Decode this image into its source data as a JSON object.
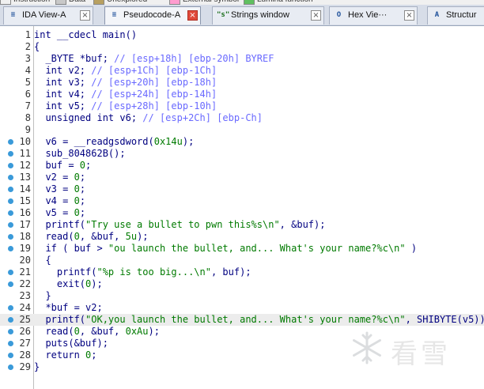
{
  "legend": [
    {
      "label": "Instruction",
      "color": "#f0f0f0"
    },
    {
      "label": "Data",
      "color": "#c8c8c8"
    },
    {
      "label": "Unexplored",
      "color": "#b8a060"
    },
    {
      "label": "External symbol",
      "color": "#ff9ccf"
    },
    {
      "label": "Lumina function",
      "color": "#60c060"
    }
  ],
  "tabs": [
    {
      "label": "IDA View-A",
      "icon": "ida-view-icon",
      "glyph": "≡",
      "active": false
    },
    {
      "label": "Pseudocode-A",
      "icon": "pseudocode-icon",
      "glyph": "≡",
      "active": true
    },
    {
      "label": "Strings window",
      "icon": "strings-icon",
      "glyph": "\"s\"",
      "active": false
    },
    {
      "label": "Hex Vie···",
      "icon": "hex-view-icon",
      "glyph": "O",
      "active": false
    },
    {
      "label": "Structur",
      "icon": "structures-icon",
      "glyph": "A",
      "active": false
    }
  ],
  "code_lines": [
    {
      "n": "1",
      "dot": false,
      "hl": false,
      "tokens": [
        [
          "kw",
          "int"
        ],
        [
          "txt",
          " __cdecl main()"
        ]
      ]
    },
    {
      "n": "2",
      "dot": false,
      "hl": false,
      "tokens": [
        [
          "blk",
          "{"
        ]
      ]
    },
    {
      "n": "3",
      "dot": false,
      "hl": false,
      "tokens": [
        [
          "txt",
          "  _BYTE *buf; "
        ],
        [
          "cm",
          "// [esp+18h] [ebp-20h] BYREF"
        ]
      ]
    },
    {
      "n": "4",
      "dot": false,
      "hl": false,
      "tokens": [
        [
          "txt",
          "  int v2; "
        ],
        [
          "cm",
          "// [esp+1Ch] [ebp-1Ch]"
        ]
      ]
    },
    {
      "n": "5",
      "dot": false,
      "hl": false,
      "tokens": [
        [
          "txt",
          "  int v3; "
        ],
        [
          "cm",
          "// [esp+20h] [ebp-18h]"
        ]
      ]
    },
    {
      "n": "6",
      "dot": false,
      "hl": false,
      "tokens": [
        [
          "txt",
          "  int v4; "
        ],
        [
          "cm",
          "// [esp+24h] [ebp-14h]"
        ]
      ]
    },
    {
      "n": "7",
      "dot": false,
      "hl": false,
      "tokens": [
        [
          "txt",
          "  int v5; "
        ],
        [
          "cm",
          "// [esp+28h] [ebp-10h]"
        ]
      ]
    },
    {
      "n": "8",
      "dot": false,
      "hl": false,
      "tokens": [
        [
          "txt",
          "  unsigned int v6; "
        ],
        [
          "cm",
          "// [esp+2Ch] [ebp-Ch]"
        ]
      ]
    },
    {
      "n": "9",
      "dot": false,
      "hl": false,
      "tokens": []
    },
    {
      "n": "10",
      "dot": true,
      "hl": false,
      "tokens": [
        [
          "txt",
          "  v6 = __readgsdword("
        ],
        [
          "num",
          "0x14u"
        ],
        [
          "txt",
          ");"
        ]
      ]
    },
    {
      "n": "11",
      "dot": true,
      "hl": false,
      "tokens": [
        [
          "txt",
          "  sub_804862B();"
        ]
      ]
    },
    {
      "n": "12",
      "dot": true,
      "hl": false,
      "tokens": [
        [
          "txt",
          "  buf = "
        ],
        [
          "num",
          "0"
        ],
        [
          "txt",
          ";"
        ]
      ]
    },
    {
      "n": "13",
      "dot": true,
      "hl": false,
      "tokens": [
        [
          "txt",
          "  v2 = "
        ],
        [
          "num",
          "0"
        ],
        [
          "txt",
          ";"
        ]
      ]
    },
    {
      "n": "14",
      "dot": true,
      "hl": false,
      "tokens": [
        [
          "txt",
          "  v3 = "
        ],
        [
          "num",
          "0"
        ],
        [
          "txt",
          ";"
        ]
      ]
    },
    {
      "n": "15",
      "dot": true,
      "hl": false,
      "tokens": [
        [
          "txt",
          "  v4 = "
        ],
        [
          "num",
          "0"
        ],
        [
          "txt",
          ";"
        ]
      ]
    },
    {
      "n": "16",
      "dot": true,
      "hl": false,
      "tokens": [
        [
          "txt",
          "  v5 = "
        ],
        [
          "num",
          "0"
        ],
        [
          "txt",
          ";"
        ]
      ]
    },
    {
      "n": "17",
      "dot": true,
      "hl": false,
      "tokens": [
        [
          "txt",
          "  printf("
        ],
        [
          "str",
          "\"Try use a bullet to pwn this%s\\n\""
        ],
        [
          "txt",
          ", &buf);"
        ]
      ]
    },
    {
      "n": "18",
      "dot": true,
      "hl": false,
      "tokens": [
        [
          "txt",
          "  read("
        ],
        [
          "num",
          "0"
        ],
        [
          "txt",
          ", &buf, "
        ],
        [
          "num",
          "5u"
        ],
        [
          "txt",
          ");"
        ]
      ]
    },
    {
      "n": "19",
      "dot": true,
      "hl": false,
      "tokens": [
        [
          "txt",
          "  if ( buf > "
        ],
        [
          "str",
          "\"ou launch the bullet, and... What's your name?%c\\n\""
        ],
        [
          "txt",
          " )"
        ]
      ]
    },
    {
      "n": "20",
      "dot": false,
      "hl": false,
      "tokens": [
        [
          "blk",
          "  {"
        ]
      ]
    },
    {
      "n": "21",
      "dot": true,
      "hl": false,
      "tokens": [
        [
          "txt",
          "    printf("
        ],
        [
          "str",
          "\"%p is too big...\\n\""
        ],
        [
          "txt",
          ", buf);"
        ]
      ]
    },
    {
      "n": "22",
      "dot": true,
      "hl": false,
      "tokens": [
        [
          "txt",
          "    exit("
        ],
        [
          "num",
          "0"
        ],
        [
          "txt",
          ");"
        ]
      ]
    },
    {
      "n": "23",
      "dot": false,
      "hl": false,
      "tokens": [
        [
          "blk",
          "  }"
        ]
      ]
    },
    {
      "n": "24",
      "dot": true,
      "hl": false,
      "tokens": [
        [
          "txt",
          "  *buf = v2;"
        ]
      ]
    },
    {
      "n": "25",
      "dot": true,
      "hl": true,
      "tokens": [
        [
          "txt",
          "  printf("
        ],
        [
          "str",
          "\"OK,you launch the bullet, and... What's your name?%c\\n\""
        ],
        [
          "txt",
          ", SHIBYTE(v5));"
        ]
      ]
    },
    {
      "n": "26",
      "dot": true,
      "hl": false,
      "tokens": [
        [
          "txt",
          "  read("
        ],
        [
          "num",
          "0"
        ],
        [
          "txt",
          ", &buf, "
        ],
        [
          "num",
          "0xAu"
        ],
        [
          "txt",
          ");"
        ]
      ]
    },
    {
      "n": "27",
      "dot": true,
      "hl": false,
      "tokens": [
        [
          "txt",
          "  puts(&buf);"
        ]
      ]
    },
    {
      "n": "28",
      "dot": true,
      "hl": false,
      "tokens": [
        [
          "txt",
          "  return "
        ],
        [
          "num",
          "0"
        ],
        [
          "txt",
          ";"
        ]
      ]
    },
    {
      "n": "29",
      "dot": true,
      "hl": false,
      "tokens": [
        [
          "blk",
          "}"
        ]
      ]
    }
  ],
  "watermark": {
    "text": "看雪",
    "icon": "snowflake-logo-icon"
  }
}
